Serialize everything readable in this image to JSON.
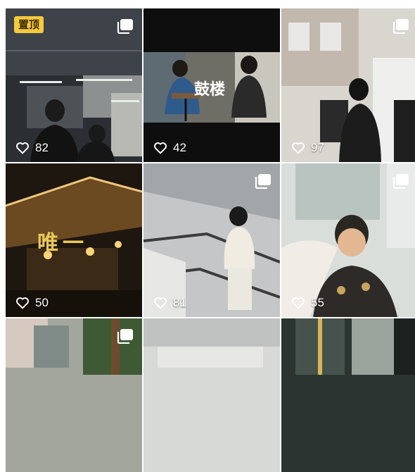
{
  "tiles": [
    {
      "likes": "82",
      "pinned_label": "置顶",
      "multi": true
    },
    {
      "likes": "42",
      "overlay": "鼓楼",
      "multi": false
    },
    {
      "likes": "97",
      "multi": true
    },
    {
      "likes": "50",
      "overlay": "唯一",
      "multi": false
    },
    {
      "likes": "81",
      "multi": true
    },
    {
      "likes": "55",
      "multi": true
    },
    {
      "likes": "",
      "multi": true
    },
    {
      "likes": "",
      "multi": false
    },
    {
      "likes": "",
      "multi": false
    }
  ],
  "icons": {
    "like": "heart-outline-icon",
    "multi": "multi-image-icon"
  }
}
